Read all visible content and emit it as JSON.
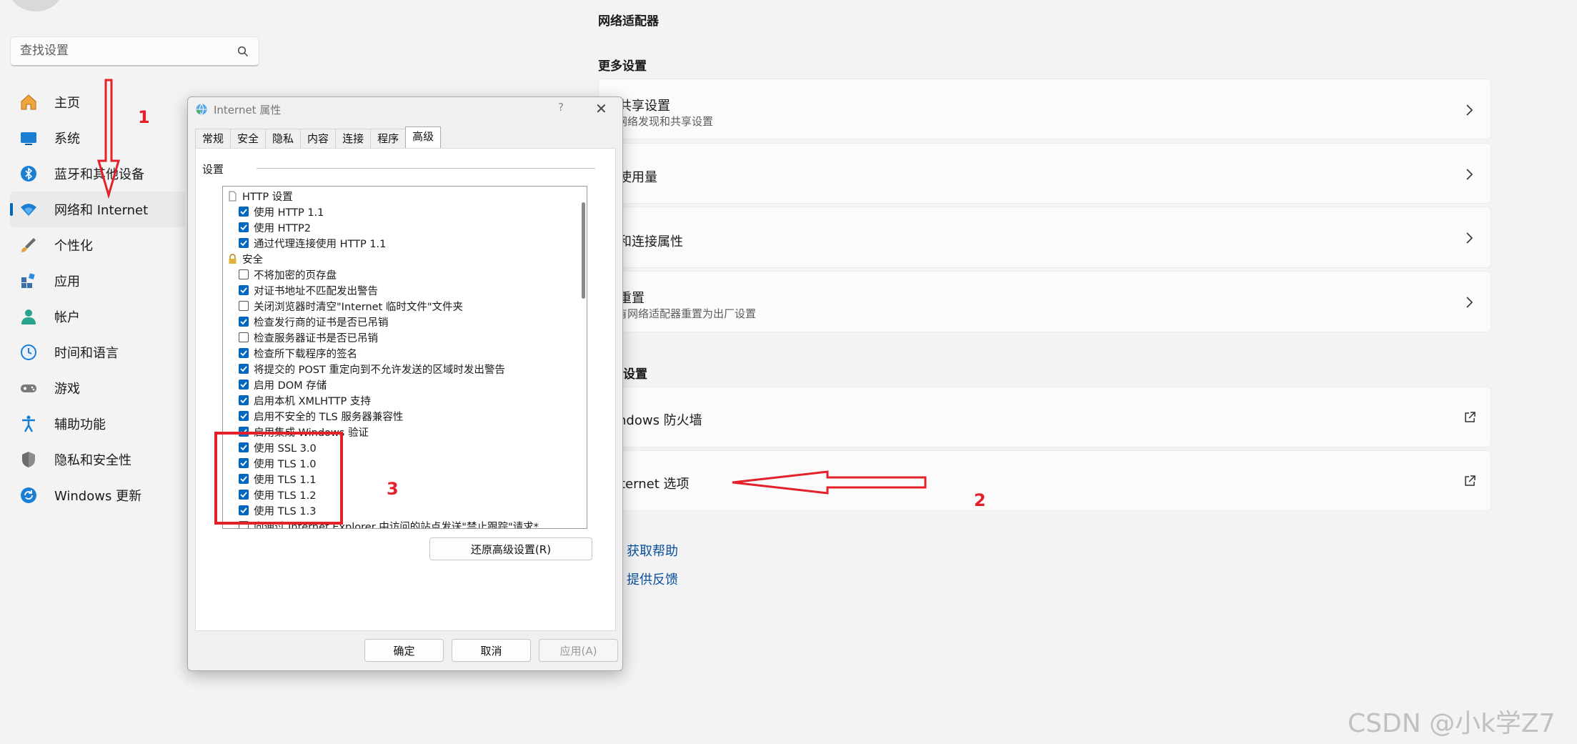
{
  "search": {
    "placeholder": "查找设置"
  },
  "nav": {
    "items": [
      {
        "label": "主页",
        "icon": "home-icon"
      },
      {
        "label": "系统",
        "icon": "system-icon"
      },
      {
        "label": "蓝牙和其他设备",
        "icon": "bluetooth-icon"
      },
      {
        "label": "网络和 Internet",
        "icon": "wifi-icon",
        "active": true
      },
      {
        "label": "个性化",
        "icon": "brush-icon"
      },
      {
        "label": "应用",
        "icon": "apps-icon"
      },
      {
        "label": "帐户",
        "icon": "account-icon"
      },
      {
        "label": "时间和语言",
        "icon": "clock-icon"
      },
      {
        "label": "游戏",
        "icon": "gamepad-icon"
      },
      {
        "label": "辅助功能",
        "icon": "accessibility-icon"
      },
      {
        "label": "隐私和安全性",
        "icon": "shield-icon"
      },
      {
        "label": "Windows 更新",
        "icon": "update-icon"
      }
    ]
  },
  "content": {
    "network_adapter_title": "网络适配器",
    "more_settings_title": "更多设置",
    "cards": [
      {
        "title": "级共享设置",
        "subtitle": "改网络发现和共享设置"
      },
      {
        "title": "据使用量"
      },
      {
        "title": "件和连接属性"
      },
      {
        "title": "络重置",
        "subtitle": "所有网络适配器重置为出厂设置"
      }
    ],
    "related_title": "设置",
    "related_cards": [
      {
        "title": "indows 防火墙"
      },
      {
        "title": "ternet 选项"
      }
    ],
    "help_links": [
      {
        "label": "获取帮助",
        "icon": "help-icon"
      },
      {
        "label": "提供反馈",
        "icon": "feedback-icon"
      }
    ]
  },
  "dialog": {
    "title": "Internet 属性",
    "help_glyph": "?",
    "close_glyph": "✕",
    "tabs": [
      "常规",
      "安全",
      "隐私",
      "内容",
      "连接",
      "程序",
      "高级"
    ],
    "active_tab": "高级",
    "settings_label": "设置",
    "rows": [
      {
        "kind": "group",
        "label": "HTTP 设置",
        "icon": "page-icon"
      },
      {
        "kind": "child",
        "label": "使用 HTTP 1.1",
        "checked": true
      },
      {
        "kind": "child",
        "label": "使用 HTTP2",
        "checked": true
      },
      {
        "kind": "child",
        "label": "通过代理连接使用 HTTP 1.1",
        "checked": true
      },
      {
        "kind": "group",
        "label": "安全",
        "icon": "lock-icon"
      },
      {
        "kind": "child",
        "label": "不将加密的页存盘",
        "checked": false
      },
      {
        "kind": "child",
        "label": "对证书地址不匹配发出警告",
        "checked": true
      },
      {
        "kind": "child",
        "label": "关闭浏览器时清空\"Internet 临时文件\"文件夹",
        "checked": false
      },
      {
        "kind": "child",
        "label": "检查发行商的证书是否已吊销",
        "checked": true
      },
      {
        "kind": "child",
        "label": "检查服务器证书是否已吊销",
        "checked": false
      },
      {
        "kind": "child",
        "label": "检查所下载程序的签名",
        "checked": true
      },
      {
        "kind": "child",
        "label": "将提交的 POST 重定向到不允许发送的区域时发出警告",
        "checked": true
      },
      {
        "kind": "child",
        "label": "启用 DOM 存储",
        "checked": true
      },
      {
        "kind": "child",
        "label": "启用本机 XMLHTTP 支持",
        "checked": true
      },
      {
        "kind": "child",
        "label": "启用不安全的 TLS 服务器兼容性",
        "checked": true
      },
      {
        "kind": "child",
        "label": "启用集成 Windows 验证",
        "checked": true
      },
      {
        "kind": "child",
        "label": "使用 SSL 3.0",
        "checked": true
      },
      {
        "kind": "child",
        "label": "使用 TLS 1.0",
        "checked": true
      },
      {
        "kind": "child",
        "label": "使用 TLS 1.1",
        "checked": true
      },
      {
        "kind": "child",
        "label": "使用 TLS 1.2",
        "checked": true
      },
      {
        "kind": "child",
        "label": "使用 TLS 1.3",
        "checked": true
      },
      {
        "kind": "child",
        "label": "向通过 Internet Explorer 中访问的站点发送\"禁止跟踪\"请求*",
        "checked": false
      }
    ],
    "restore_button": "还原高级设置(R)",
    "ok_button": "确定",
    "cancel_button": "取消",
    "apply_button": "应用(A)"
  },
  "annotations": {
    "n1": "1",
    "n2": "2",
    "n3": "3",
    "color": "#e4202a"
  },
  "watermark": "CSDN @小k学Z7",
  "colors": {
    "accent": "#0067c0",
    "link": "#0b4f9c"
  }
}
